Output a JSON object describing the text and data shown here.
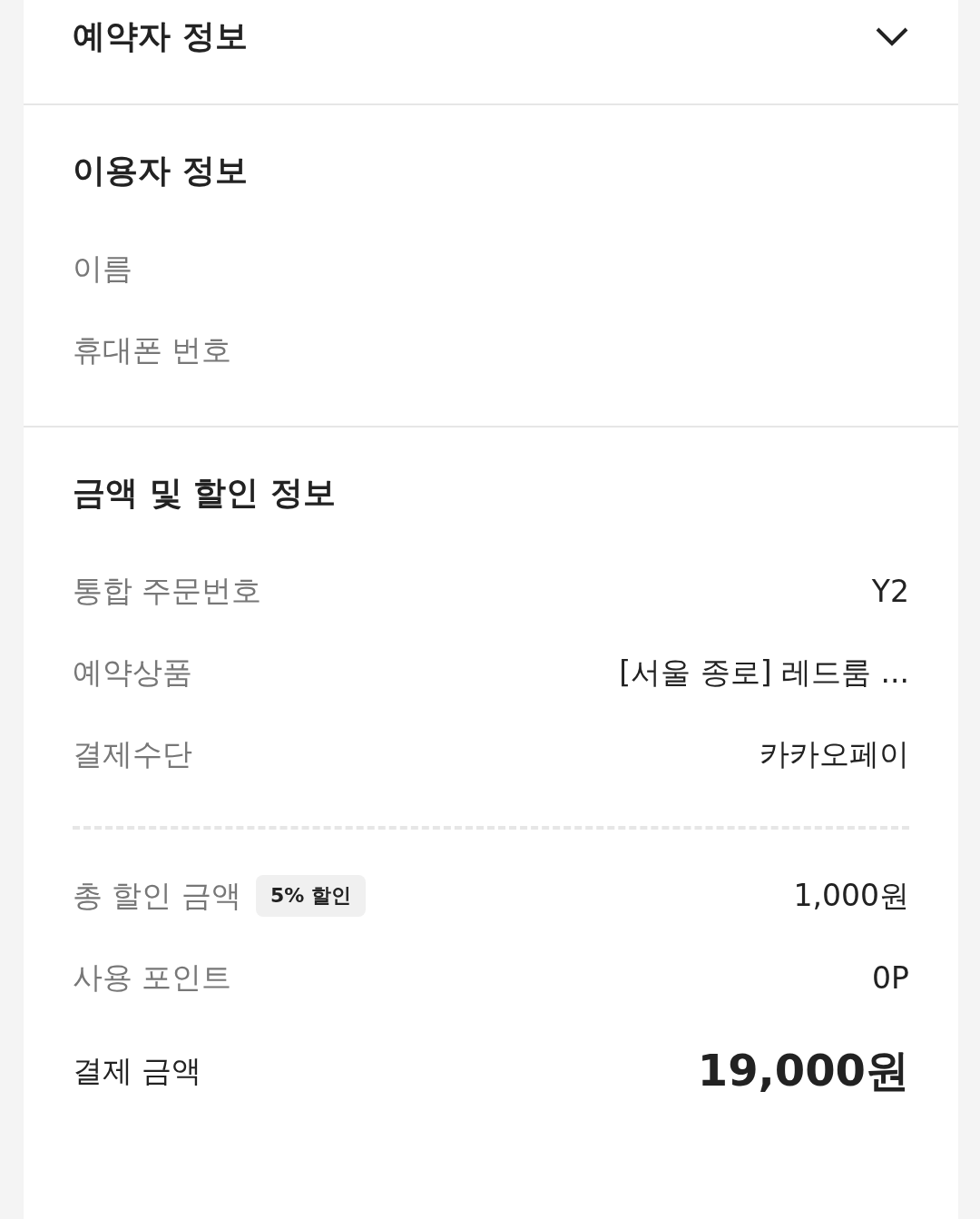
{
  "booker_section": {
    "title": "예약자 정보",
    "expanded": false
  },
  "user_section": {
    "title": "이용자 정보",
    "rows": [
      {
        "label": "이름"
      },
      {
        "label": "휴대폰 번호"
      }
    ]
  },
  "payment_section": {
    "title": "금액 및 할인 정보",
    "rows": [
      {
        "label": "통합 주문번호",
        "value": "Y2"
      },
      {
        "label": "예약상품",
        "value": "[서울 종로] 레드룸 ..."
      },
      {
        "label": "결제수단",
        "value": "카카오페이"
      }
    ],
    "summary": [
      {
        "label": "총 할인 금액",
        "badge": "5% 할인",
        "value": "1,000원",
        "kind": "normal"
      },
      {
        "label": "사용 포인트",
        "value": "0P",
        "kind": "normal"
      },
      {
        "label": "결제 금액",
        "value": "19,000원",
        "kind": "total"
      }
    ]
  }
}
